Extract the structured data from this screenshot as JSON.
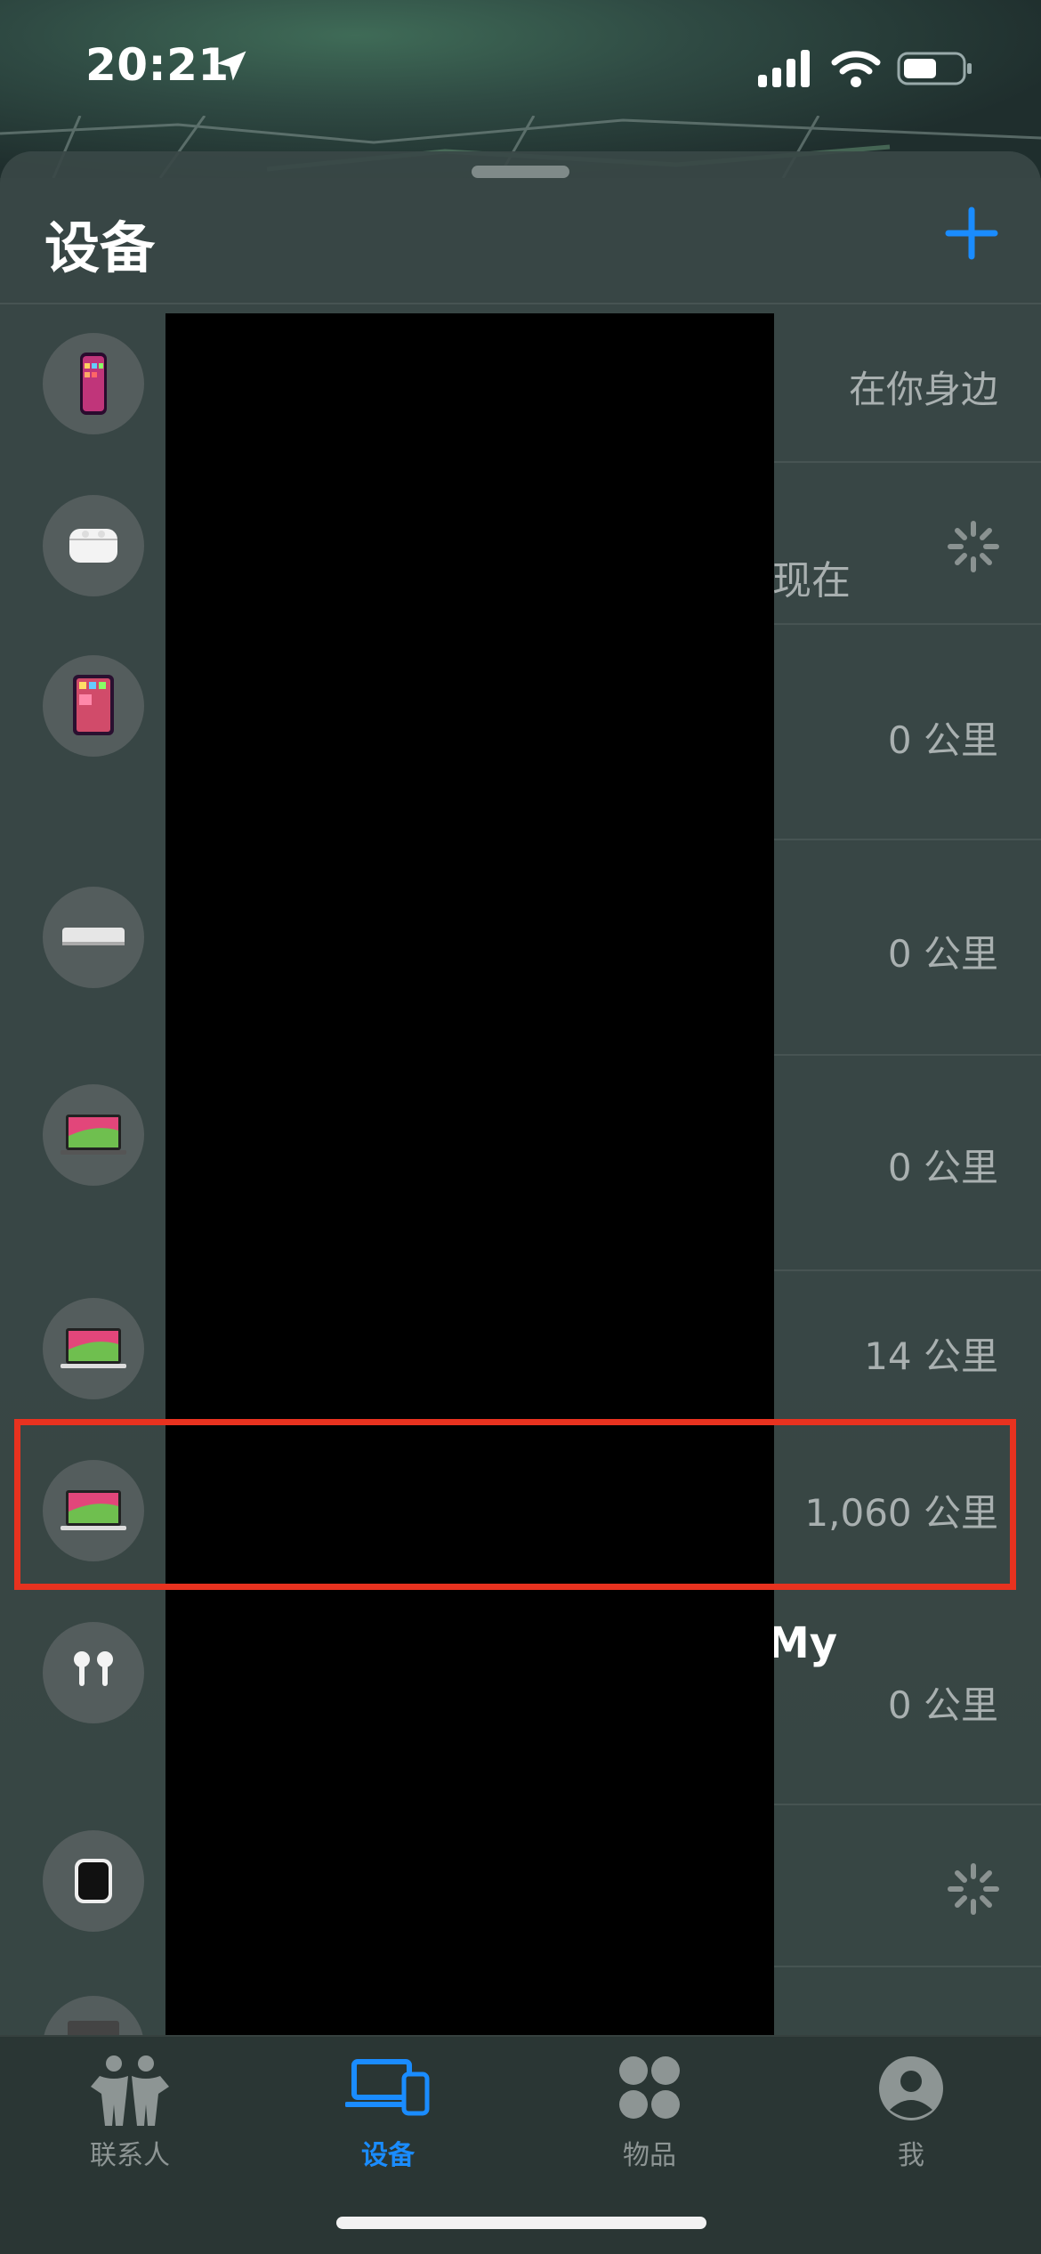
{
  "status_bar": {
    "time": "20:21"
  },
  "header": {
    "title": "设备"
  },
  "devices": [
    {
      "icon": "iphone-icon",
      "status": "在你身边"
    },
    {
      "icon": "airpods-pro-case-icon",
      "status": "现在",
      "loading": true
    },
    {
      "icon": "ipad-icon",
      "status": "0 公里"
    },
    {
      "icon": "mac-mini-icon",
      "status": "0 公里"
    },
    {
      "icon": "macbook-icon",
      "status": "0 公里"
    },
    {
      "icon": "macbook-icon",
      "status": "14 公里"
    },
    {
      "icon": "macbook-icon",
      "status": "1,060 公里"
    },
    {
      "icon": "airpods-icon",
      "name_fragment": "My",
      "status": "0 公里"
    },
    {
      "icon": "apple-watch-icon",
      "loading": true
    },
    {
      "icon": "mac-icon"
    }
  ],
  "tabs": [
    {
      "label": "联系人",
      "icon": "people-icon"
    },
    {
      "label": "设备",
      "icon": "devices-icon",
      "active": true
    },
    {
      "label": "物品",
      "icon": "items-icon"
    },
    {
      "label": "我",
      "icon": "me-icon"
    }
  ],
  "colors": {
    "accent": "#1a8cff",
    "highlight_border": "#e8321f"
  }
}
